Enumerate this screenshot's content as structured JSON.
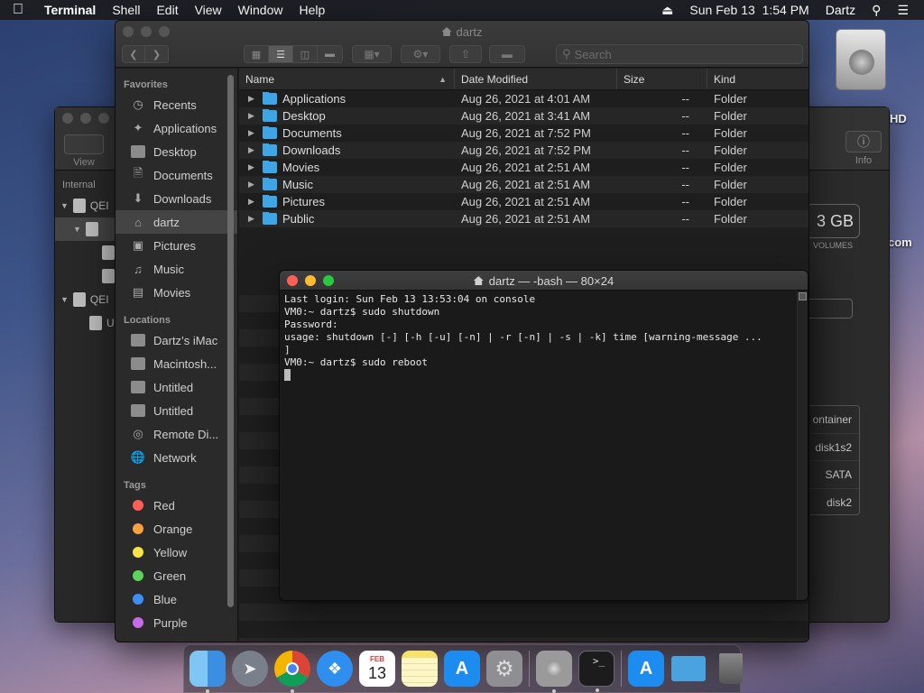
{
  "menubar": {
    "apple_icon": "apple-logo-icon",
    "app_name": "Terminal",
    "menus": [
      "Shell",
      "Edit",
      "View",
      "Window",
      "Help"
    ],
    "eject_icon": "eject-icon",
    "clock": "Sun Feb 13  1:54 PM",
    "user": "Dartz",
    "search_icon": "spotlight-icon",
    "list_icon": "notification-center-icon"
  },
  "desktop": {
    "hd_label_fragment": "HD",
    "com_fragment": "com"
  },
  "disk_utility": {
    "view_label": "View",
    "info_label": "Info",
    "sidebar_header": "Internal",
    "sidebar_rows": [
      {
        "label": "QEI",
        "level": 0
      },
      {
        "label": "",
        "level": 1,
        "selected": true
      },
      {
        "label": "",
        "level": 2
      },
      {
        "label": "",
        "level": 2
      },
      {
        "label": "QEI",
        "level": 0
      },
      {
        "label": "U",
        "level": 1
      }
    ],
    "capacity_fragment": "3 GB",
    "volumes_label": "VOLUMES",
    "info_values": [
      "ontainer",
      "disk1s2",
      "SATA",
      "disk2"
    ]
  },
  "finder": {
    "title": "dartz",
    "search_placeholder": "Search",
    "sidebar": {
      "favorites_header": "Favorites",
      "favorites": [
        {
          "label": "Recents",
          "icon": "clock-icon"
        },
        {
          "label": "Applications",
          "icon": "applications-icon"
        },
        {
          "label": "Desktop",
          "icon": "desktop-icon"
        },
        {
          "label": "Documents",
          "icon": "document-icon"
        },
        {
          "label": "Downloads",
          "icon": "download-icon"
        },
        {
          "label": "dartz",
          "icon": "home-icon",
          "selected": true
        },
        {
          "label": "Pictures",
          "icon": "camera-icon"
        },
        {
          "label": "Music",
          "icon": "music-note-icon"
        },
        {
          "label": "Movies",
          "icon": "film-icon"
        }
      ],
      "locations_header": "Locations",
      "locations": [
        {
          "label": "Dartz’s iMac",
          "icon": "imac-icon"
        },
        {
          "label": "Macintosh...",
          "icon": "drive-icon"
        },
        {
          "label": "Untitled",
          "icon": "drive-icon"
        },
        {
          "label": "Untitled",
          "icon": "drive-icon"
        },
        {
          "label": "Remote Di...",
          "icon": "disc-icon"
        },
        {
          "label": "Network",
          "icon": "globe-icon"
        }
      ],
      "tags_header": "Tags",
      "tags": [
        {
          "label": "Red",
          "color": "#ff5f57"
        },
        {
          "label": "Orange",
          "color": "#f9a03f"
        },
        {
          "label": "Yellow",
          "color": "#f7e24a"
        },
        {
          "label": "Green",
          "color": "#5ed35b"
        },
        {
          "label": "Blue",
          "color": "#3d8ef7"
        },
        {
          "label": "Purple",
          "color": "#c76ae6"
        }
      ]
    },
    "columns": {
      "name": "Name",
      "date": "Date Modified",
      "size": "Size",
      "kind": "Kind"
    },
    "rows": [
      {
        "name": "Applications",
        "date": "Aug 26, 2021 at 4:01 AM",
        "size": "--",
        "kind": "Folder"
      },
      {
        "name": "Desktop",
        "date": "Aug 26, 2021 at 3:41 AM",
        "size": "--",
        "kind": "Folder"
      },
      {
        "name": "Documents",
        "date": "Aug 26, 2021 at 7:52 PM",
        "size": "--",
        "kind": "Folder"
      },
      {
        "name": "Downloads",
        "date": "Aug 26, 2021 at 7:52 PM",
        "size": "--",
        "kind": "Folder"
      },
      {
        "name": "Movies",
        "date": "Aug 26, 2021 at 2:51 AM",
        "size": "--",
        "kind": "Folder"
      },
      {
        "name": "Music",
        "date": "Aug 26, 2021 at 2:51 AM",
        "size": "--",
        "kind": "Folder"
      },
      {
        "name": "Pictures",
        "date": "Aug 26, 2021 at 2:51 AM",
        "size": "--",
        "kind": "Folder"
      },
      {
        "name": "Public",
        "date": "Aug 26, 2021 at 2:51 AM",
        "size": "--",
        "kind": "Folder"
      }
    ]
  },
  "terminal": {
    "title": "dartz — -bash — 80×24",
    "lines": [
      "Last login: Sun Feb 13 13:53:04 on console",
      "VM0:~ dartz$ sudo shutdown",
      "Password:",
      "usage: shutdown [-] [-h [-u] [-n] | -r [-n] | -s | -k] time [warning-message ...",
      "]",
      "VM0:~ dartz$ sudo reboot"
    ]
  },
  "dock": {
    "items": [
      {
        "name": "Finder",
        "icon": "finder-icon",
        "color": "#3b8fe0",
        "running": true
      },
      {
        "name": "Launchpad",
        "icon": "rocket-icon",
        "color": "#7a7f8c",
        "running": false
      },
      {
        "name": "Chrome",
        "icon": "chrome-icon",
        "color": "#e9e9e9",
        "running": true
      },
      {
        "name": "Safari",
        "icon": "compass-icon",
        "color": "#2f8ff0",
        "running": false
      },
      {
        "name": "Calendar",
        "icon": "calendar-icon",
        "color": "#ffffff",
        "running": false,
        "month": "FEB",
        "day": "13"
      },
      {
        "name": "Notes",
        "icon": "notes-icon",
        "color": "#f6e16b",
        "running": false
      },
      {
        "name": "App Store",
        "icon": "app-store-icon",
        "color": "#1d8cf0",
        "running": false
      },
      {
        "name": "System Preferences",
        "icon": "gear-icon",
        "color": "#8e8e93",
        "running": false
      },
      {
        "name": "Disk Utility",
        "icon": "disk-utility-icon",
        "color": "#9a9a9a",
        "running": true
      },
      {
        "name": "Terminal",
        "icon": "terminal-icon",
        "color": "#1c1c1c",
        "running": true
      },
      {
        "name": "App Store Downloads",
        "icon": "app-store-icon",
        "color": "#1d8cf0",
        "running": false
      },
      {
        "name": "Downloads Folder",
        "icon": "folder-icon",
        "color": "#4aa3df",
        "running": false
      },
      {
        "name": "Trash",
        "icon": "trash-icon",
        "color": "#6b6b6b",
        "running": false
      }
    ]
  }
}
